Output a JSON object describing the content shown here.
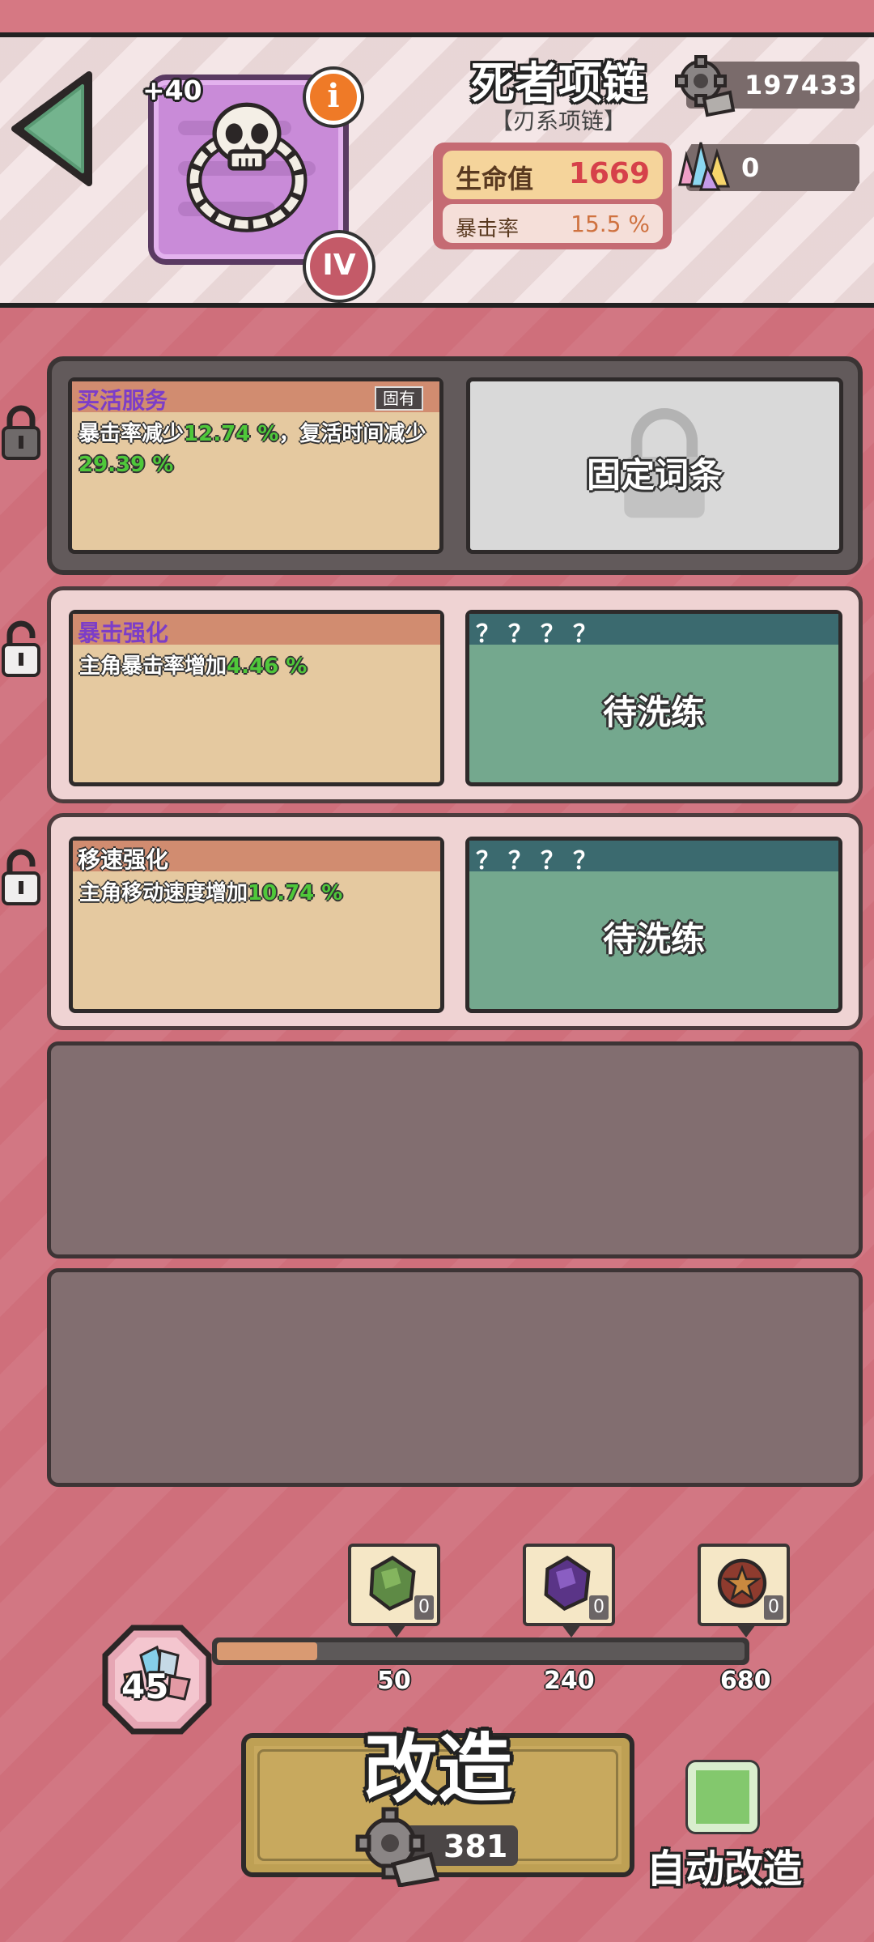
{
  "item": {
    "name": "死者项链",
    "type": "【刃系项链】",
    "enhance_level": "+40",
    "tier": "IV",
    "info_icon": "i"
  },
  "stats": {
    "hp_label": "生命值",
    "hp_value": "1669",
    "crit_label": "暴击率",
    "crit_value": "15.5 %"
  },
  "currency": {
    "gear": "197433",
    "gem": "0"
  },
  "affixes": [
    {
      "title": "买活服务",
      "tag": "固有",
      "desc_a": "暴击率减少",
      "value_a": "12.74 %",
      "desc_b": "，复活时间减少",
      "value_b": "29.39 %",
      "slot_text": "固定词条"
    },
    {
      "title": "暴击强化",
      "desc_a": "主角暴击率增加",
      "value_a": "4.46 %",
      "slot_header": "？？？？",
      "slot_text": "待洗练"
    },
    {
      "title": "移速强化",
      "desc_a": "主角移动速度增加",
      "value_a": "10.74 %",
      "slot_header": "？？？？",
      "slot_text": "待洗练"
    }
  ],
  "progress": {
    "count": "45",
    "fill_ratio": 0.19,
    "milestones": [
      "50",
      "240",
      "680"
    ],
    "rewards": [
      "0",
      "0",
      "0"
    ]
  },
  "reforge": {
    "label": "改造",
    "cost": "381"
  },
  "auto": {
    "label": "自动改造"
  },
  "icons": {
    "back": "back-arrow-icon",
    "gear": "gear-icon",
    "gem": "crystal-icon",
    "lock": "lock-icon",
    "unlock": "unlock-icon"
  }
}
